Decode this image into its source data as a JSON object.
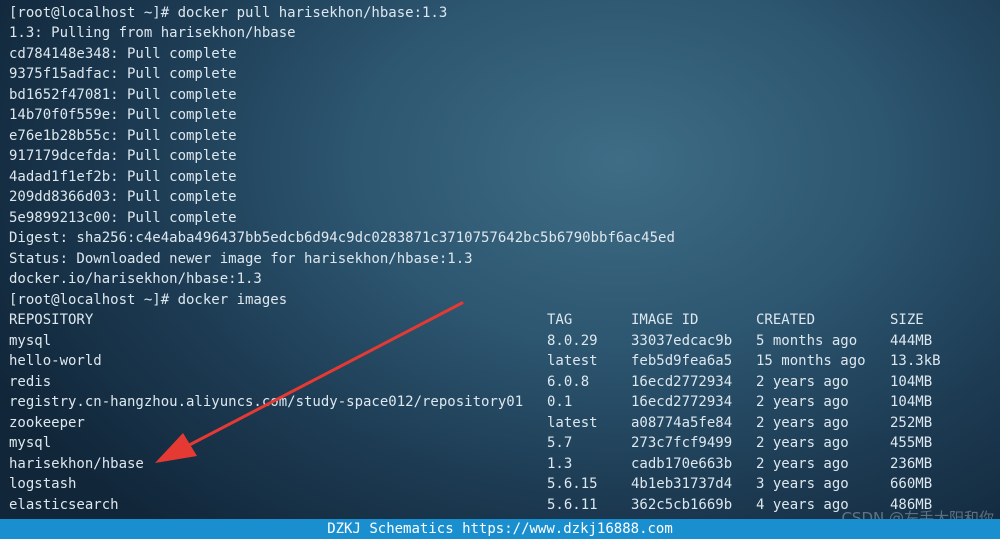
{
  "terminal": {
    "lines": [
      "[root@localhost ~]# docker pull harisekhon/hbase:1.3",
      "1.3: Pulling from harisekhon/hbase",
      "cd784148e348: Pull complete",
      "9375f15adfac: Pull complete",
      "bd1652f47081: Pull complete",
      "14b70f0f559e: Pull complete",
      "e76e1b28b55c: Pull complete",
      "917179dcefda: Pull complete",
      "4adad1f1ef2b: Pull complete",
      "209dd8366d03: Pull complete",
      "5e9899213c00: Pull complete",
      "Digest: sha256:c4e4aba496437bb5edcb6d94c9dc0283871c3710757642bc5b6790bbf6ac45ed",
      "Status: Downloaded newer image for harisekhon/hbase:1.3",
      "docker.io/harisekhon/hbase:1.3",
      "[root@localhost ~]# docker images"
    ],
    "images_table": {
      "headers": [
        "REPOSITORY",
        "TAG",
        "IMAGE ID",
        "CREATED",
        "SIZE"
      ],
      "rows": [
        [
          "mysql",
          "8.0.29",
          "33037edcac9b",
          "5 months ago",
          "444MB"
        ],
        [
          "hello-world",
          "latest",
          "feb5d9fea6a5",
          "15 months ago",
          "13.3kB"
        ],
        [
          "redis",
          "6.0.8",
          "16ecd2772934",
          "2 years ago",
          "104MB"
        ],
        [
          "registry.cn-hangzhou.aliyuncs.com/study-space012/repository01",
          "0.1",
          "16ecd2772934",
          "2 years ago",
          "104MB"
        ],
        [
          "zookeeper",
          "latest",
          "a08774a5fe84",
          "2 years ago",
          "252MB"
        ],
        [
          "mysql",
          "5.7",
          "273c7fcf9499",
          "2 years ago",
          "455MB"
        ],
        [
          "harisekhon/hbase",
          "1.3",
          "cadb170e663b",
          "2 years ago",
          "236MB"
        ],
        [
          "logstash",
          "5.6.15",
          "4b1eb31737d4",
          "3 years ago",
          "660MB"
        ],
        [
          "elasticsearch",
          "5.6.11",
          "362c5cb1669b",
          "4 years ago",
          "486MB"
        ]
      ]
    }
  },
  "watermark": "CSDN @左手大阳和你",
  "footer": "DZKJ Schematics https://www.dzkj16888.com",
  "colors": {
    "text": "#dde7ee",
    "arrow": "#e53a33",
    "footer_bg": "#1a8fd0"
  }
}
